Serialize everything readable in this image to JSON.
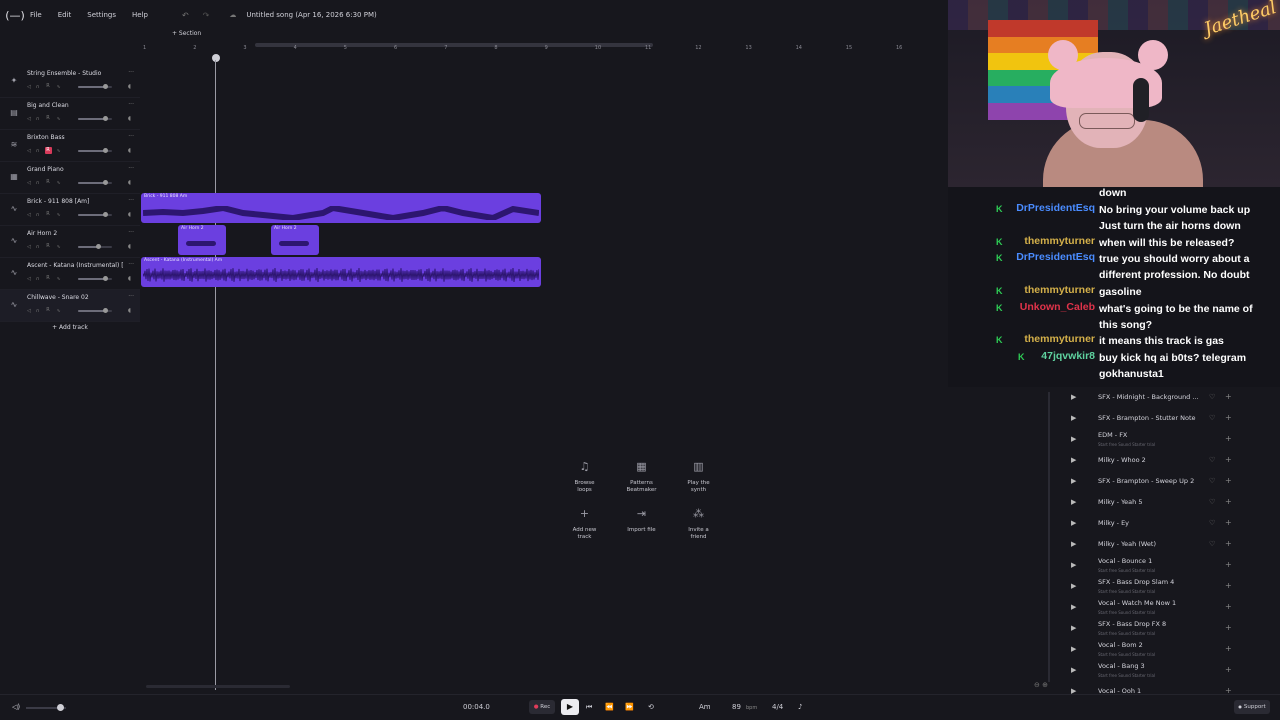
{
  "menu": {
    "logo": "(—)",
    "items": [
      "File",
      "Edit",
      "Settings",
      "Help"
    ],
    "undo": "↶",
    "redo": "↷",
    "cloud": "☁",
    "song_title": "Untitled song (Apr 16, 2026 6:30 PM)"
  },
  "timeline": {
    "section_label": "+ Section",
    "bars": [
      "1",
      "2",
      "3",
      "4",
      "5",
      "6",
      "7",
      "8",
      "9",
      "10",
      "11",
      "12",
      "13",
      "14",
      "15",
      "16"
    ]
  },
  "tracks": [
    {
      "name": "String Ensemble - Studio",
      "icon": "✦",
      "volume": 0.8,
      "armed": false
    },
    {
      "name": "Big and Clean",
      "icon": "▤",
      "volume": 0.8,
      "armed": false
    },
    {
      "name": "Brixton Bass",
      "icon": "≋",
      "volume": 0.8,
      "armed": true
    },
    {
      "name": "Grand Piano",
      "icon": "▦",
      "volume": 0.8,
      "armed": false
    },
    {
      "name": "Brick - 911 808 [Am]",
      "icon": "∿",
      "volume": 0.8,
      "armed": false
    },
    {
      "name": "Air Horn 2",
      "icon": "∿",
      "volume": 0.6,
      "armed": false
    },
    {
      "name": "Ascent - Katana (Instrumental) [...",
      "icon": "∿",
      "volume": 0.8,
      "armed": false
    },
    {
      "name": "Chillwave - Snare 02",
      "icon": "∿",
      "volume": 0.8,
      "armed": false
    }
  ],
  "track_controls": {
    "mute": "◁",
    "solo": "∩",
    "record": "R",
    "automation": "∿",
    "more": "···",
    "pan": "◖"
  },
  "add_track": "+ Add track",
  "clips": [
    {
      "label": "Brick - 911 808 Am"
    },
    {
      "label": "Air Horn 2"
    },
    {
      "label": "Air Horn 2"
    },
    {
      "label": "Ascent - Katana (Instrumental) Am"
    }
  ],
  "actions": [
    {
      "icon": "♫",
      "label1": "Browse",
      "label2": "loops"
    },
    {
      "icon": "▦",
      "label1": "Patterns",
      "label2": "Beatmaker"
    },
    {
      "icon": "▥",
      "label1": "Play the",
      "label2": "synth"
    },
    {
      "icon": "+",
      "label1": "Add new",
      "label2": "track"
    },
    {
      "icon": "⇥",
      "label1": "Import file",
      "label2": ""
    },
    {
      "icon": "⁂",
      "label1": "Invite a",
      "label2": "friend"
    }
  ],
  "webcam": {
    "logo": "Jaetheal"
  },
  "chat": [
    {
      "user": "",
      "text": "down",
      "user_color": "#ffffff"
    },
    {
      "user": "DrPresidentEsq",
      "text": "No bring your volume back up Just turn the air horns down",
      "user_color": "#4a8cff"
    },
    {
      "user": "themmyturner",
      "text": "when will this be released?",
      "user_color": "#d4b04a"
    },
    {
      "user": "DrPresidentEsq",
      "text": "true you should worry about a different profession. No doubt",
      "user_color": "#4a8cff"
    },
    {
      "user": "themmyturner",
      "text": "gasoline",
      "user_color": "#d4b04a"
    },
    {
      "user": "Unkown_Caleb",
      "text": "what's going to be the name of this song?",
      "user_color": "#e0334a"
    },
    {
      "user": "themmyturner",
      "text": "it means this track is gas",
      "user_color": "#d4b04a"
    },
    {
      "user": "47jqvwkir8",
      "text": "buy kick hq ai b0ts? telegram gokhanusta1",
      "user_color": "#5fd3a0"
    }
  ],
  "sounds": [
    {
      "name": "SFX - Midnight - Background ...",
      "sub": "",
      "liked": true
    },
    {
      "name": "SFX - Brampton - Stutter Note",
      "sub": "",
      "liked": true
    },
    {
      "name": "EDM - FX",
      "sub": "Start free Sound Starter trial",
      "liked": false
    },
    {
      "name": "Milky - Whoo 2",
      "sub": "",
      "liked": true
    },
    {
      "name": "SFX - Brampton - Sweep Up 2",
      "sub": "",
      "liked": true
    },
    {
      "name": "Milky - Yeah 5",
      "sub": "",
      "liked": true
    },
    {
      "name": "Milky - Ey",
      "sub": "",
      "liked": true
    },
    {
      "name": "Milky - Yeah (Wet)",
      "sub": "",
      "liked": true
    },
    {
      "name": "Vocal - Bounce 1",
      "sub": "Start free Sound Starter trial",
      "liked": false
    },
    {
      "name": "SFX - Bass Drop Slam 4",
      "sub": "Start free Sound Starter trial",
      "liked": false
    },
    {
      "name": "Vocal - Watch Me Now 1",
      "sub": "Start free Sound Starter trial",
      "liked": false
    },
    {
      "name": "SFX - Bass Drop FX 8",
      "sub": "Start free Sound Starter trial",
      "liked": false
    },
    {
      "name": "Vocal - Bom 2",
      "sub": "Start free Sound Starter trial",
      "liked": false
    },
    {
      "name": "Vocal - Bang 3",
      "sub": "Start free Sound Starter trial",
      "liked": false
    },
    {
      "name": "Vocal - Ooh 1",
      "sub": "",
      "liked": false
    }
  ],
  "transport": {
    "speaker": "◁)",
    "master_volume": 0.8,
    "time": "00:04.0",
    "rec": "Rec",
    "play": "▶",
    "to_start": "⏮",
    "rewind": "⏪",
    "forward": "⏩",
    "loop": "⟲",
    "key": "Am",
    "bpm_value": "89",
    "bpm_unit": "bpm",
    "time_sig": "4/4",
    "metronome": "♪",
    "support": "Support",
    "support_icon": "●"
  },
  "zoom": "⊖ ⊕",
  "colors": {
    "clip": "#6b3fe0",
    "record": "#e03c5a",
    "chat_badge": "#2ecc55"
  }
}
